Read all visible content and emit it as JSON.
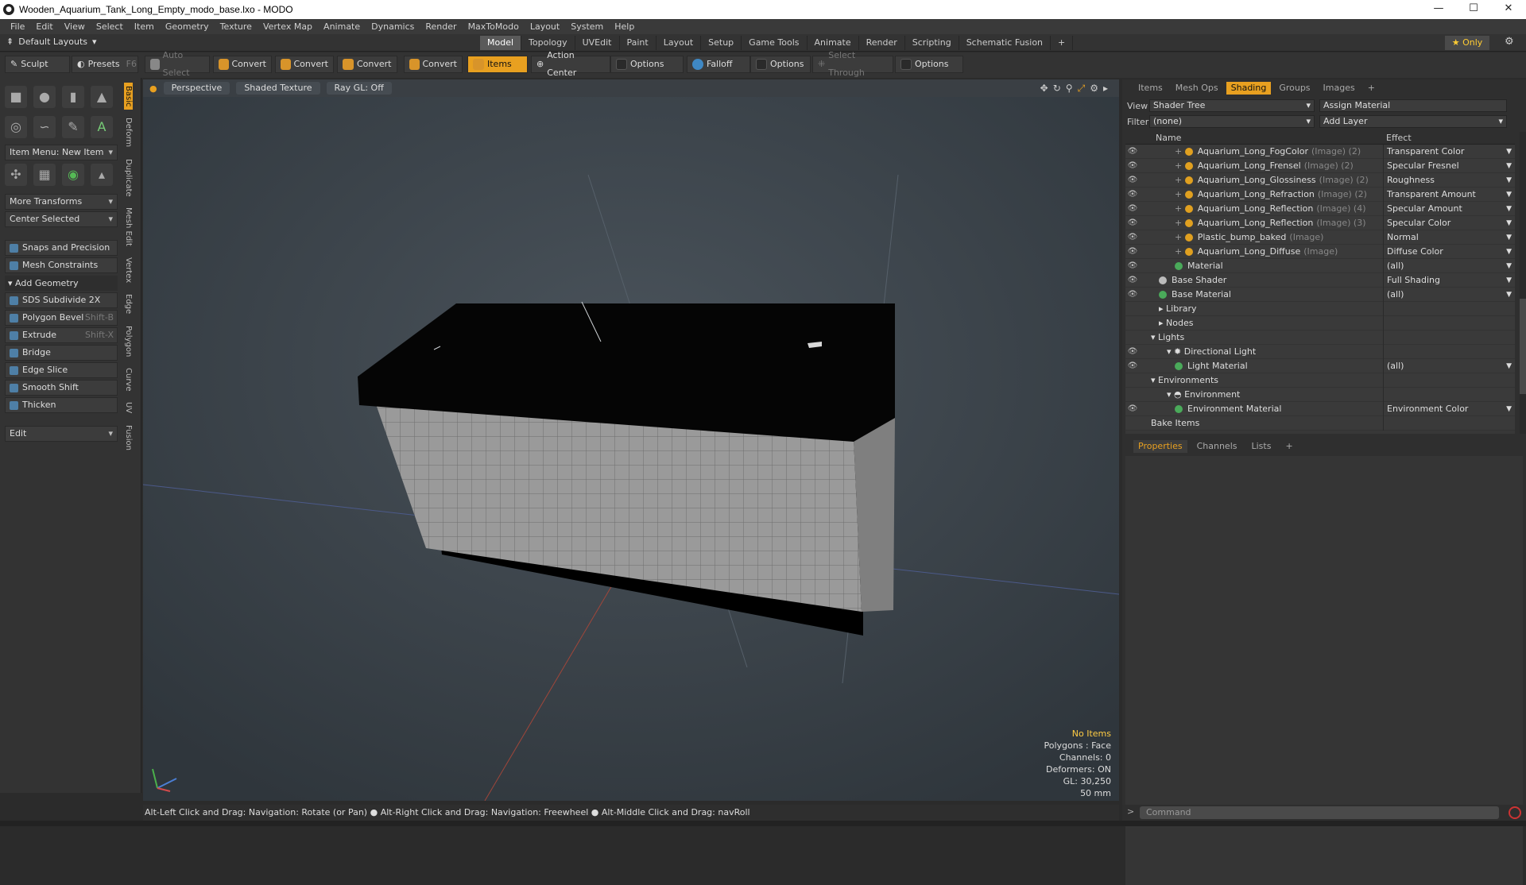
{
  "window": {
    "title": "Wooden_Aquarium_Tank_Long_Empty_modo_base.lxo - MODO",
    "minimize": "—",
    "maximize": "☐",
    "close": "✕"
  },
  "menu": [
    "File",
    "Edit",
    "View",
    "Select",
    "Item",
    "Geometry",
    "Texture",
    "Vertex Map",
    "Animate",
    "Dynamics",
    "Render",
    "MaxToModo",
    "Layout",
    "System",
    "Help"
  ],
  "layout": {
    "selector": "Default Layouts",
    "tabs": [
      "Model",
      "Topology",
      "UVEdit",
      "Paint",
      "Layout",
      "Setup",
      "Game Tools",
      "Animate",
      "Render",
      "Scripting",
      "Schematic Fusion"
    ],
    "active_tab": "Model",
    "add": "+",
    "only": "Only"
  },
  "toolbar": {
    "sculpt": "Sculpt",
    "presets": "Presets",
    "presets_key": "F6",
    "auto_select": "Auto Select",
    "convert": "Convert",
    "items": "Items",
    "action_center": "Action Center",
    "options": "Options",
    "falloff": "Falloff",
    "select_through": "Select Through"
  },
  "left": {
    "tabs": [
      "Basic",
      "Deform",
      "Duplicate",
      "Mesh Edit",
      "Vertex",
      "Edge",
      "Polygon",
      "Curve",
      "UV",
      "Fusion"
    ],
    "item_menu": "Item Menu: New Item",
    "more_transforms": "More Transforms",
    "center_selected": "Center Selected",
    "snaps": "Snaps and Precision",
    "mesh_constraints": "Mesh Constraints",
    "add_geometry": "Add Geometry",
    "tools": [
      {
        "label": "SDS Subdivide 2X",
        "key": ""
      },
      {
        "label": "Polygon Bevel",
        "key": "Shift-B"
      },
      {
        "label": "Extrude",
        "key": "Shift-X"
      },
      {
        "label": "Bridge",
        "key": ""
      },
      {
        "label": "Edge Slice",
        "key": ""
      },
      {
        "label": "Smooth Shift",
        "key": ""
      },
      {
        "label": "Thicken",
        "key": ""
      }
    ],
    "edit": "Edit"
  },
  "viewport": {
    "perspective": "Perspective",
    "shading": "Shaded Texture",
    "raygl": "Ray GL: Off",
    "info": {
      "no_items": "No Items",
      "polygons": "Polygons : Face",
      "channels": "Channels: 0",
      "deformers": "Deformers: ON",
      "gl": "GL: 30,250",
      "lens": "50 mm"
    },
    "status": "Alt-Left Click and Drag: Navigation: Rotate (or Pan) ● Alt-Right Click and Drag: Navigation: Freewheel ● Alt-Middle Click and Drag: navRoll"
  },
  "right": {
    "tabs": [
      "Items",
      "Mesh Ops",
      "Shading",
      "Groups",
      "Images",
      "+"
    ],
    "active_tab": "Shading",
    "view_label": "View",
    "view_value": "Shader Tree",
    "assign_material": "Assign Material",
    "filter_label": "Filter",
    "filter_value": "(none)",
    "add_layer": "Add Layer",
    "col_name": "Name",
    "col_effect": "Effect",
    "rows": [
      {
        "name": "Aquarium_Long_FogColor",
        "suffix": "(Image) (2)",
        "effect": "Transparent Color",
        "indent": 4,
        "kind": "img",
        "eye": true
      },
      {
        "name": "Aquarium_Long_Frensel",
        "suffix": "(Image) (2)",
        "effect": "Specular Fresnel",
        "indent": 4,
        "kind": "img",
        "eye": true
      },
      {
        "name": "Aquarium_Long_Glossiness",
        "suffix": "(Image) (2)",
        "effect": "Roughness",
        "indent": 4,
        "kind": "img",
        "eye": true
      },
      {
        "name": "Aquarium_Long_Refraction",
        "suffix": "(Image) (2)",
        "effect": "Transparent Amount",
        "indent": 4,
        "kind": "img",
        "eye": true
      },
      {
        "name": "Aquarium_Long_Reflection",
        "suffix": "(Image) (4)",
        "effect": "Specular Amount",
        "indent": 4,
        "kind": "img",
        "eye": true
      },
      {
        "name": "Aquarium_Long_Reflection",
        "suffix": "(Image) (3)",
        "effect": "Specular Color",
        "indent": 4,
        "kind": "img",
        "eye": true
      },
      {
        "name": "Plastic_bump_baked",
        "suffix": "(Image)",
        "effect": "Normal",
        "indent": 4,
        "kind": "img",
        "eye": true
      },
      {
        "name": "Aquarium_Long_Diffuse",
        "suffix": "(Image)",
        "effect": "Diffuse Color",
        "indent": 4,
        "kind": "img",
        "eye": true
      },
      {
        "name": "Material",
        "suffix": "",
        "effect": "(all)",
        "indent": 4,
        "kind": "mat",
        "eye": true
      },
      {
        "name": "Base Shader",
        "suffix": "",
        "effect": "Full Shading",
        "indent": 2,
        "kind": "grey",
        "eye": true
      },
      {
        "name": "Base Material",
        "suffix": "",
        "effect": "(all)",
        "indent": 2,
        "kind": "mat",
        "eye": true
      },
      {
        "name": "Library",
        "suffix": "",
        "effect": "",
        "indent": 2,
        "kind": "folder",
        "eye": false
      },
      {
        "name": "Nodes",
        "suffix": "",
        "effect": "",
        "indent": 2,
        "kind": "folder",
        "eye": false
      },
      {
        "name": "Lights",
        "suffix": "",
        "effect": "",
        "indent": 1,
        "kind": "group",
        "eye": false
      },
      {
        "name": "Directional Light",
        "suffix": "",
        "effect": "",
        "indent": 3,
        "kind": "light",
        "eye": true
      },
      {
        "name": "Light Material",
        "suffix": "",
        "effect": "(all)",
        "indent": 4,
        "kind": "mat",
        "eye": true
      },
      {
        "name": "Environments",
        "suffix": "",
        "effect": "",
        "indent": 1,
        "kind": "group",
        "eye": false
      },
      {
        "name": "Environment",
        "suffix": "",
        "effect": "",
        "indent": 3,
        "kind": "env",
        "eye": false
      },
      {
        "name": "Environment Material",
        "suffix": "",
        "effect": "Environment Color",
        "indent": 4,
        "kind": "mat",
        "eye": true
      },
      {
        "name": "Bake Items",
        "suffix": "",
        "effect": "",
        "indent": 1,
        "kind": "none",
        "eye": false
      }
    ],
    "prop_tabs": [
      "Properties",
      "Channels",
      "Lists",
      "+"
    ],
    "command_placeholder": "Command"
  }
}
